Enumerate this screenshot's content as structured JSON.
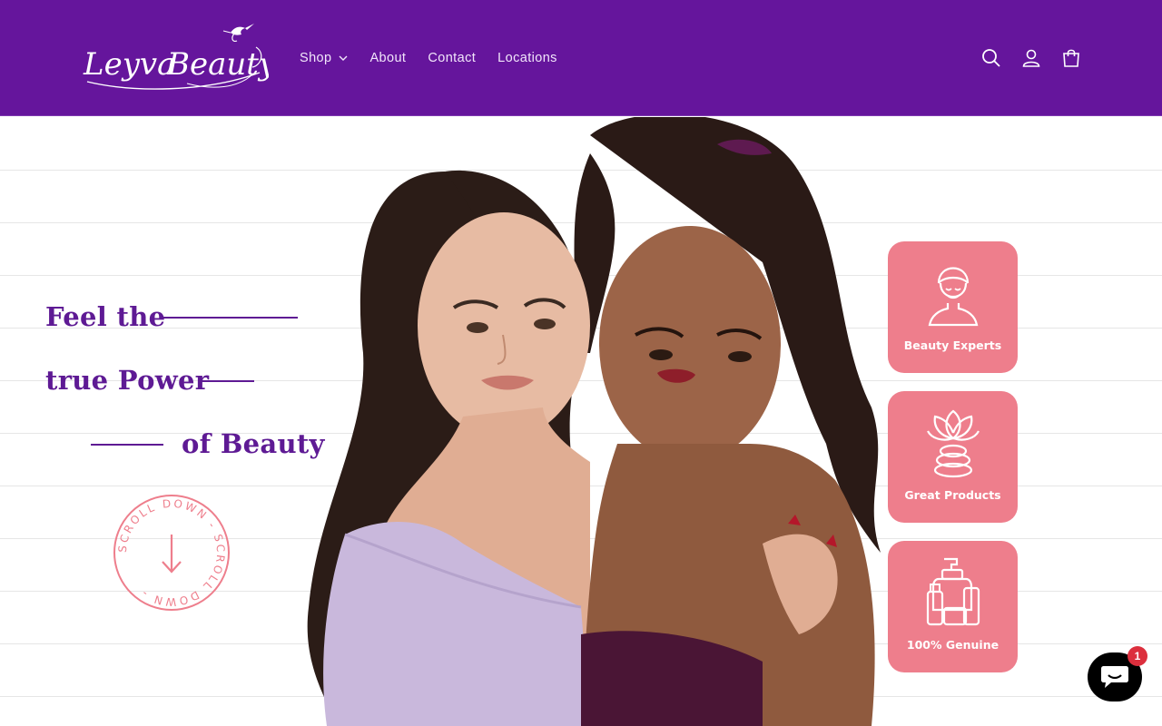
{
  "brand": {
    "logo_text": "Leyva Beauty",
    "header_bg": "#65159c",
    "accent_pink": "#ee7e8c"
  },
  "nav": {
    "shop": "Shop",
    "about": "About",
    "contact": "Contact",
    "locations": "Locations"
  },
  "header_icons": [
    "search-icon",
    "account-icon",
    "cart-icon"
  ],
  "hero": {
    "line1": "Feel the",
    "line2": "true Power",
    "line3": "of Beauty",
    "scroll_text": "SCROLL DOWN - SCROLL DOWN -",
    "headline_color": "#5e1a94"
  },
  "features": [
    {
      "label": "Beauty Experts",
      "icon": "beauty-expert-icon"
    },
    {
      "label": "Great Products",
      "icon": "spa-lotus-icon"
    },
    {
      "label": "100% Genuine",
      "icon": "cosmetic-bottles-icon"
    }
  ],
  "chat": {
    "badge_count": "1",
    "icon": "chat-bubble-icon"
  }
}
